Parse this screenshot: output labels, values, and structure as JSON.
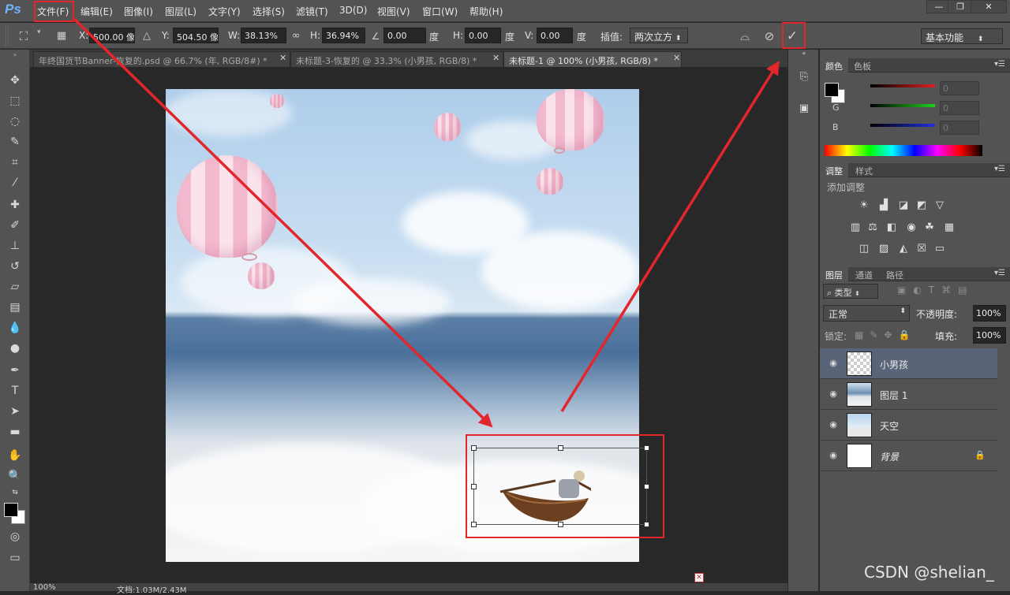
{
  "app": {
    "logo": "Ps"
  },
  "menu": [
    "文件(F)",
    "编辑(E)",
    "图像(I)",
    "图层(L)",
    "文字(Y)",
    "选择(S)",
    "滤镜(T)",
    "3D(D)",
    "视图(V)",
    "窗口(W)",
    "帮助(H)"
  ],
  "window_buttons": {
    "minimize": "—",
    "restore": "❐",
    "close": "✕"
  },
  "options_bar": {
    "x_label": "X:",
    "x_value": "500.00 像素",
    "y_label": "Y:",
    "y_value": "504.50 像素",
    "w_label": "W:",
    "w_value": "38.13%",
    "h_label": "H:",
    "h_value": "36.94%",
    "angle_value": "0.00",
    "angle_unit": "度",
    "hskew_label": "H:",
    "hskew_value": "0.00",
    "hskew_unit": "度",
    "vskew_label": "V:",
    "vskew_value": "0.00",
    "vskew_unit": "度",
    "interp_label": "插值:",
    "interp_value": "两次立方",
    "workspace": "基本功能"
  },
  "doc_tabs": [
    {
      "label": "年终国货节Banner-恢复的.psd @ 66.7% (年, RGB/8#) *",
      "active": false
    },
    {
      "label": "未标题-3-恢复的 @ 33.3% (小男孩, RGB/8) *",
      "active": false
    },
    {
      "label": "未标题-1 @ 100% (小男孩, RGB/8) *",
      "active": true
    }
  ],
  "color_panel": {
    "tabs": [
      "颜色",
      "色板"
    ],
    "channels": [
      {
        "label": "R",
        "value": "0",
        "color": "#e02020"
      },
      {
        "label": "G",
        "value": "0",
        "color": "#1fd01f"
      },
      {
        "label": "B",
        "value": "0",
        "color": "#2030e0"
      }
    ]
  },
  "adjust_panel": {
    "tabs": [
      "调整",
      "样式"
    ],
    "add_label": "添加调整",
    "icons": [
      "brightness-icon",
      "levels-icon",
      "curves-icon",
      "exposure-icon",
      "vibrance-icon",
      "hue-icon",
      "color-balance-icon",
      "bw-icon",
      "photo-filter-icon",
      "channel-mixer-icon",
      "color-lookup-icon",
      "invert-icon",
      "posterize-icon",
      "threshold-icon",
      "selective-color-icon",
      "gradient-map-icon"
    ]
  },
  "layers_panel": {
    "tabs": [
      "图层",
      "通道",
      "路径"
    ],
    "filter_label": "类型",
    "blend_mode": "正常",
    "opacity_label": "不透明度:",
    "opacity_value": "100%",
    "lock_label": "锁定:",
    "fill_label": "填充:",
    "fill_value": "100%",
    "layers": [
      {
        "name": "小男孩",
        "selected": true
      },
      {
        "name": "图层 1",
        "selected": false
      },
      {
        "name": "天空",
        "selected": false
      },
      {
        "name": "背景",
        "selected": false,
        "locked": true
      }
    ]
  },
  "status": {
    "zoom": "100%",
    "doc": "文档:1.03M/2.43M"
  },
  "watermark": "CSDN @shelian_",
  "accent": "#e3262b"
}
